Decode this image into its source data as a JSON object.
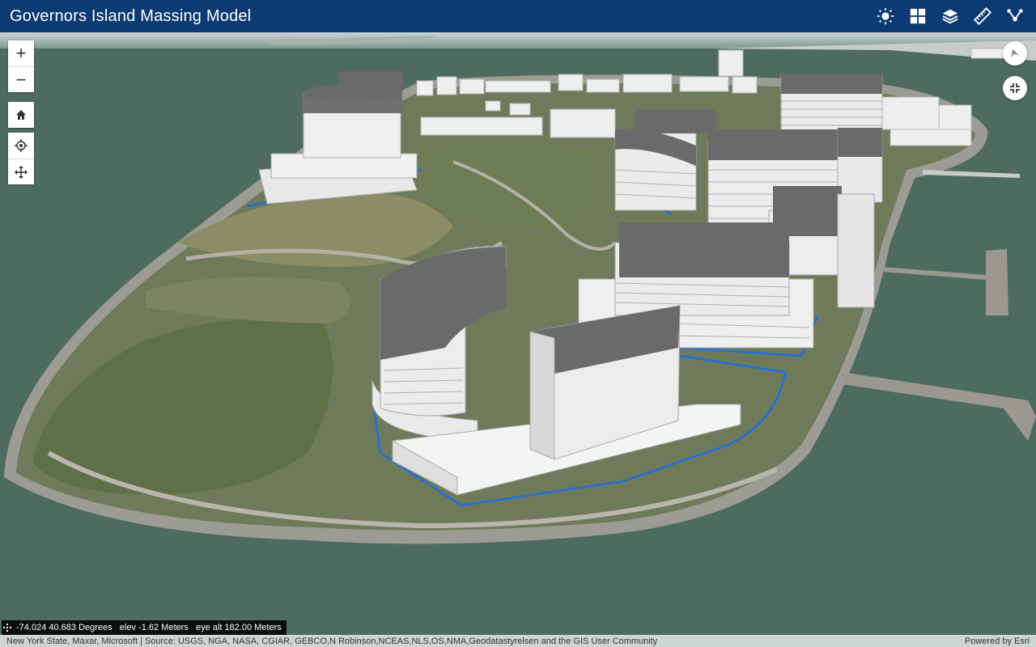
{
  "app": {
    "title": "Governors Island Massing Model"
  },
  "header_tools": [
    {
      "name": "daylight-icon",
      "label": "Daylight"
    },
    {
      "name": "basemap-gallery-icon",
      "label": "Basemap Gallery"
    },
    {
      "name": "layers-icon",
      "label": "Layer List"
    },
    {
      "name": "measure-icon",
      "label": "Measure"
    },
    {
      "name": "share-icon",
      "label": "Share"
    }
  ],
  "map_controls": {
    "zoom_in": "+",
    "zoom_out": "−",
    "home_icon": "home-icon",
    "locate_icon": "locate-icon",
    "navigation_icon": "pan-icon",
    "compass_icon": "compass-icon",
    "fullscreen_icon": "exit-fullscreen-icon"
  },
  "coordinates": {
    "text": "-74.024 40.683 Degrees   elev -1.62 Meters   eye alt 182.00 Meters"
  },
  "attribution": {
    "source": "New York State, Maxar, Microsoft | Source: USGS, NGA, NASA, CGIAR, GEBCO,N Robinson,NCEAS,NLS,OS,NMA,Geodatastyrelsen and the GIS User Community",
    "powered": "Powered by Esri"
  },
  "colors": {
    "header": "#0d3a73",
    "water": "#4e6b60",
    "outline": "#1e6fe0",
    "building_roof": "#6a6a6a",
    "building_wall": "#e6e6e6"
  }
}
